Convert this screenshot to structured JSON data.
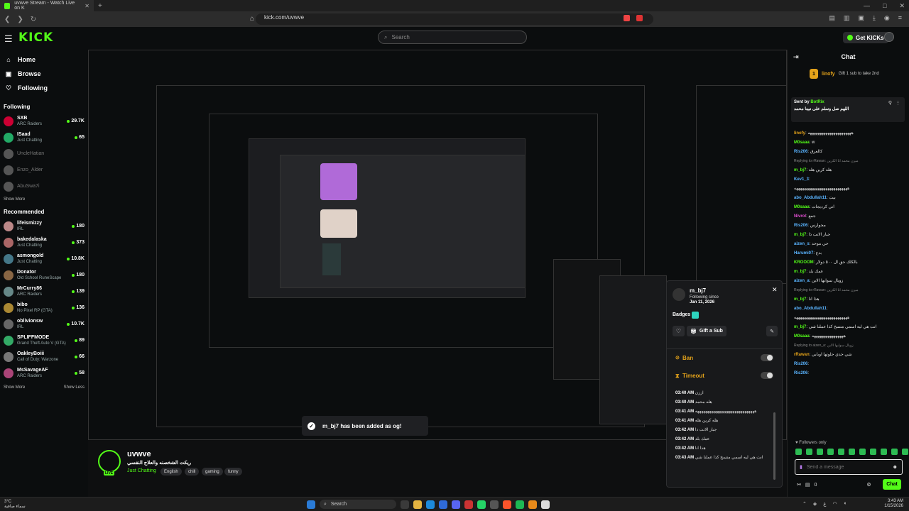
{
  "browser": {
    "tab_title": "uvwve Stream - Watch Live on K",
    "url": "kick.com/uvwve",
    "new_tab": "+",
    "window_controls": [
      "—",
      "□",
      "✕"
    ]
  },
  "header": {
    "logo": "KICK",
    "search_placeholder": "Search",
    "get_kicks_label": "Get KICKs"
  },
  "sidebar": {
    "nav": [
      {
        "label": "Home",
        "icon": "home-icon"
      },
      {
        "label": "Browse",
        "icon": "browse-icon"
      },
      {
        "label": "Following",
        "icon": "heart-icon"
      }
    ],
    "following_title": "Following",
    "following": [
      {
        "name": "SXB",
        "game": "ARC Raiders",
        "viewers": "29.7K",
        "online": true
      },
      {
        "name": "ISaad",
        "game": "Just Chatting",
        "viewers": "65",
        "online": true
      },
      {
        "name": "UncleHatian",
        "game": "",
        "viewers": "",
        "online": false
      },
      {
        "name": "Enzo_Alder",
        "game": "",
        "viewers": "",
        "online": false
      },
      {
        "name": "AbuSwa7i",
        "game": "",
        "viewers": "",
        "online": false
      }
    ],
    "show_more": "Show More",
    "recommended_title": "Recommended",
    "recommended": [
      {
        "name": "lifeismizzy",
        "game": "IRL",
        "viewers": "180"
      },
      {
        "name": "bakedalaska",
        "game": "Just Chatting",
        "viewers": "373"
      },
      {
        "name": "asmongold",
        "game": "Just Chatting",
        "viewers": "10.8K"
      },
      {
        "name": "Donator",
        "game": "Old School RuneScape",
        "viewers": "180"
      },
      {
        "name": "MrCurry86",
        "game": "ARC Raiders",
        "viewers": "139"
      },
      {
        "name": "bibo",
        "game": "No Pixel RP (GTA)",
        "viewers": "136"
      },
      {
        "name": "oblivionsw",
        "game": "IRL",
        "viewers": "10.7K"
      },
      {
        "name": "SPLIFFMODE",
        "game": "Grand Theft Auto V (GTA)",
        "viewers": "89"
      },
      {
        "name": "OakleyBoiii",
        "game": "Call of Duty: Warzone",
        "viewers": "66"
      },
      {
        "name": "MsSavageAF",
        "game": "ARC Raiders",
        "viewers": "58"
      }
    ],
    "show_more_2": "Show More",
    "show_less": "Show Less"
  },
  "stream": {
    "streamer_name": "uvwve",
    "stream_title": "ريكت الشخصنه والعلاج النفسي",
    "category": "Just Chatting",
    "tags": [
      "English",
      "chill",
      "gaming",
      "funny"
    ],
    "live_badge": "LIVE"
  },
  "toast": {
    "message": "m_bj7 has been added as og!"
  },
  "user_card": {
    "username": "m_bj7",
    "following_since_label": "Following since",
    "following_since": "Jan 11, 2026",
    "badges_label": "Badges",
    "gift_sub_label": "Gift a Sub",
    "ban_label": "Ban",
    "timeout_label": "Timeout",
    "history": [
      {
        "time": "03:40 AM",
        "text": "اززن"
      },
      {
        "time": "03:40 AM",
        "text": "هله محمد"
      },
      {
        "time": "03:41 AM",
        "text": "ههههههههههههههههههههههههههههههه"
      },
      {
        "time": "03:41 AM",
        "text": "هله كرين هله"
      },
      {
        "time": "03:42 AM",
        "text": "جبار الانت ذا"
      },
      {
        "time": "03:42 AM",
        "text": "عمك بلد"
      },
      {
        "time": "03:42 AM",
        "text": "هذا انا"
      },
      {
        "time": "03:43 AM",
        "text": "انت هي ليه اسمي متسخ كذا عملنا شي"
      }
    ]
  },
  "chat": {
    "title": "Chat",
    "gift_user": "linofy",
    "gift_text": "Gift 1 sub to take 2nd",
    "pinned_sent_by": "Sent by",
    "pinned_user": "BotRix",
    "pinned_text": "اللهم صل وسلم على نبينا محمد",
    "messages": [
      {
        "user": "linofy",
        "color": "#e3a21a",
        "text": "ههههههههههههههههههههههه"
      },
      {
        "user": "M0saaa",
        "color": "#53fc18",
        "text": "w"
      },
      {
        "user": "Ris206",
        "color": "#5ab4ff",
        "text": "كالعرق"
      },
      {
        "reply": "Replying to rRawan: ميرن محمد انا الكرين"
      },
      {
        "user": "m_bj7",
        "color": "#53fc18",
        "text": "هله كرين هله"
      },
      {
        "user": "Kev1_3",
        "color": "#5ab4ff",
        "text": ""
      },
      {
        "user": "",
        "color": "#ffffff",
        "text": "هههههههههههههههههههههههههههه"
      },
      {
        "user": "abo_Abdullah11",
        "color": "#5ab4ff",
        "text": "بيت"
      },
      {
        "user": "M0saaa",
        "color": "#53fc18",
        "text": "اني كرديجات"
      },
      {
        "user": "Nivrol",
        "color": "#e04fd0",
        "text": "جمع"
      },
      {
        "user": "Ris206",
        "color": "#5ab4ff",
        "text": "مجوارس"
      },
      {
        "user": "m_bj7",
        "color": "#53fc18",
        "text": "جبار الانت ذا"
      },
      {
        "user": "aizen_s",
        "color": "#5ab4ff",
        "text": "حي موحد"
      },
      {
        "user": "Harumi07",
        "color": "#5ab4ff",
        "text": "بدع"
      },
      {
        "user": "KROOOM",
        "color": "#53fc18",
        "text": "بالكلك حق ال ٥٠٠ دولار"
      },
      {
        "user": "m_bj7",
        "color": "#53fc18",
        "text": "عمك بلد"
      },
      {
        "user": "aizen_a",
        "color": "#5ab4ff",
        "text": "زوبال سوابها الابن"
      },
      {
        "reply": "Replying to rRawan: ميرن محمد انا الكرين"
      },
      {
        "user": "m_bj7",
        "color": "#53fc18",
        "text": "هذا انا"
      },
      {
        "user": "abo_Abdullah11",
        "color": "#5ab4ff",
        "text": ""
      },
      {
        "user": "",
        "color": "#ffffff",
        "text": "هههههههههههههههههههههههههههه"
      },
      {
        "user": "m_bj7",
        "color": "#53fc18",
        "text": "انت هي ليه اسمي متسخ كذا عملنا شي"
      },
      {
        "user": "M0saaa",
        "color": "#53fc18",
        "text": "ههههههههههههههههه"
      },
      {
        "reply": "Replying to aizen_a: زوبال سوابها الابن"
      },
      {
        "user": "rRawan",
        "color": "#e3a21a",
        "text": "شي خدي حلوتها اوبابي"
      },
      {
        "user": "Ris206",
        "color": "#5ab4ff",
        "text": ""
      },
      {
        "user": "Ris206",
        "color": "#5ab4ff",
        "text": ""
      }
    ],
    "followers_only": "Followers only",
    "input_placeholder": "Send a message",
    "kicks_count": "0",
    "chat_button": "Chat"
  },
  "taskbar": {
    "temperature": "3°C",
    "weather_text": "سماء صافية",
    "search_label": "Search",
    "time": "3:43 AM",
    "date": "1/15/2026"
  },
  "colors": {
    "accent": "#53fc18",
    "background": "#0b0d0e"
  }
}
